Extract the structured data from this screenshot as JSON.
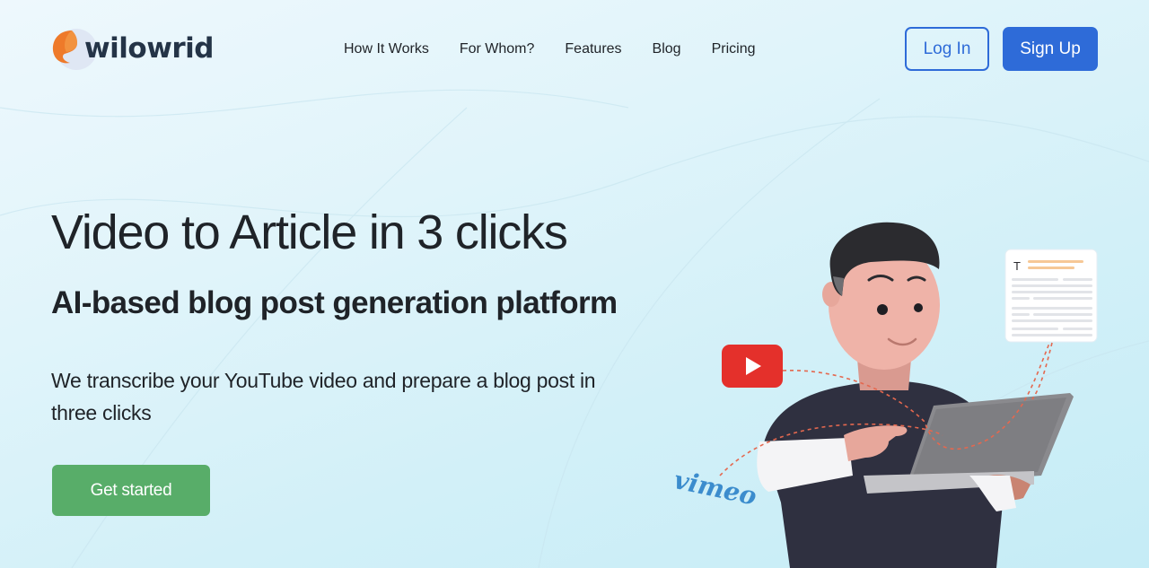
{
  "brand": {
    "name": "wilowrid",
    "accent_orange": "#ee7a2a",
    "primary_blue": "#2e6bd8",
    "cta_green": "#58ad69"
  },
  "nav": {
    "items": [
      {
        "label": "How It Works"
      },
      {
        "label": "For Whom?"
      },
      {
        "label": "Features"
      },
      {
        "label": "Blog"
      },
      {
        "label": "Pricing"
      }
    ]
  },
  "auth": {
    "login_label": "Log In",
    "signup_label": "Sign Up"
  },
  "hero": {
    "title": "Video to Article in 3 clicks",
    "subtitle": "AI-based blog post generation platform",
    "description": "We transcribe your YouTube video and prepare a blog post in three clicks",
    "cta_label": "Get started"
  },
  "illustration": {
    "source_logo_text": "vimeo",
    "document_icon_letter": "T",
    "youtube_icon": "play-icon"
  }
}
